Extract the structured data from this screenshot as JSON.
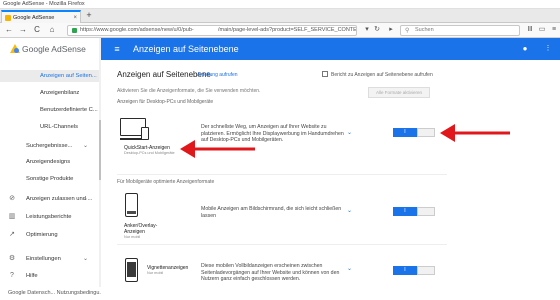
{
  "browser": {
    "title": "Google AdSense - Mozilla Firefox",
    "tab_label": "Google AdSense",
    "tab_close": "×",
    "newtab": "+",
    "back": "←",
    "forward": "→",
    "reload": "C",
    "home": "⌂",
    "url_part1": "https://www.google.com/adsense/new/u/0/pub-",
    "url_part2": "/main/page-level-ads?product=SELF_SERVICE_CONTE",
    "search_placeholder": "Suchen",
    "search_icon": "⚲",
    "icons": [
      "star-icon",
      "library-icon",
      "sidebar-icon",
      "menu-icon"
    ]
  },
  "app": {
    "logo_text": "Google AdSense",
    "header_title": "Anzeigen auf Seitenebene",
    "menu_glyph": "≡",
    "bell_glyph": "🔔",
    "more_glyph": "⋮",
    "accent": "#1a73e8"
  },
  "sidebar": {
    "items": [
      {
        "label": "Anzeigen auf Seiten...",
        "active": true
      },
      {
        "label": "Anzeigenbilanz"
      },
      {
        "label": "Benutzerdefinierte C..."
      },
      {
        "label": "URL-Channels"
      },
      {
        "label": "Suchergebnisse..."
      },
      {
        "label": "Anzeigendesigns"
      },
      {
        "label": "Sonstige Produkte"
      },
      {
        "label": "Anzeigen zulassen und ..."
      },
      {
        "label": "Leistungsberichte"
      },
      {
        "label": "Optimierung"
      },
      {
        "label": "Einstellungen"
      },
      {
        "label": "Hilfe"
      }
    ],
    "footer": "Google   Datensch...   Nutzungsbedingu..."
  },
  "main": {
    "title": "Anzeigen auf Seitenebene",
    "title_link": "Anleitung aufrufen",
    "report_link": "Bericht zu Anzeigen auf Seitenebene aufrufen",
    "subtext": "Aktivieren Sie die Anzeigenformate, die Sie verwenden möchten.",
    "section_desktop": "Anzeigen für Desktop-PCs und Mobilgeräte",
    "section_mobile": "Für Mobilgeräte optimierte Anzeigenformate",
    "disabled_button": "Alle Formate aktivieren",
    "cards": [
      {
        "name": "QuickStart-Anzeigen",
        "sub": "Desktop-PCs und Mobilgeräte",
        "desc": "Der schnellste Weg, um Anzeigen auf Ihrer Website zu platzieren. Ermöglicht Ihre Displaywerbung im Handumdrehen auf Desktop-PCs und Mobilgeräten.",
        "toggle_on": true
      },
      {
        "name": "Anker/Overlay-Anzeigen",
        "sub": "Nur mobil",
        "desc": "Mobile Anzeigen am Bildschirmrand, die sich leicht schließen lassen",
        "toggle_on": true
      },
      {
        "name": "Vignettenanzeigen",
        "sub": "Nur mobil",
        "desc": "Diese mobilen Vollbildanzeigen erscheinen zwischen Seitenladevorgängen auf Ihrer Website und können von den Nutzern ganz einfach geschlossen werden.",
        "toggle_on": true
      }
    ],
    "toggle_label": "I",
    "chevron": "⌄"
  }
}
